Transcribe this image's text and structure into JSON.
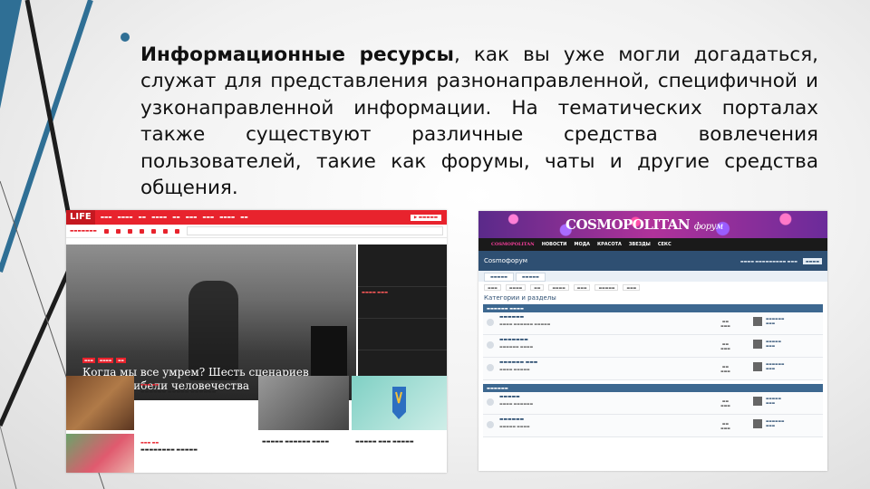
{
  "slide": {
    "bold_lead": "Информационные ресурсы",
    "body_text": ", как вы уже могли догадаться, служат для представления разнонаправленной, специфичной и узконаправленной информации. На тематических порталах также существуют различные средства вовлечения пользователей, такие как форумы, чаты и другие средства общения."
  },
  "colors": {
    "accent": "#2f6f95",
    "life_red": "#e8232d",
    "cosmo_blue": "#2e4f72"
  },
  "life": {
    "logo": "LIFE",
    "hero_title": "Когда мы все умрем? Шесть сценариев полной гибели человечества",
    "icons": [
      "facebook-icon",
      "vk-icon",
      "twitter-icon",
      "youtube-icon",
      "odnoklassniki-icon",
      "instagram-icon",
      "rss-icon"
    ]
  },
  "cosmo": {
    "logo": "COSMOPOLITAN",
    "logo_sub": "форум",
    "nav_brand": "COSMOPOLITAN",
    "nav": [
      "НОВОСТИ",
      "МОДА",
      "КРАСОТА",
      "ЗВЕЗДЫ",
      "СЕКС"
    ],
    "forum_title": "Cosmoфорум",
    "section_title": "Категории и разделы"
  }
}
